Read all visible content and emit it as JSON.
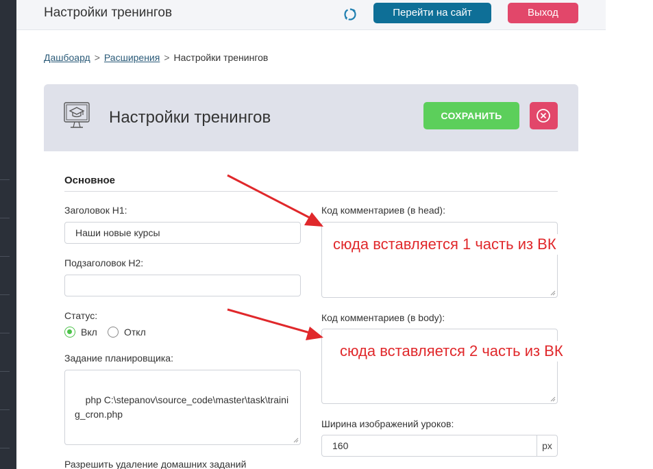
{
  "topbar": {
    "title": "Настройки тренингов",
    "sync_icon": "sync-icon",
    "go_to_site_label": "Перейти на сайт",
    "logout_label": "Выход"
  },
  "breadcrumb": {
    "items": [
      "Дашбоард",
      "Расширения",
      "Настройки тренингов"
    ],
    "separator": ">"
  },
  "panel": {
    "icon": "monitor-graduation-cap-icon",
    "title": "Настройки тренингов",
    "save_label": "СОХРАНИТЬ",
    "close_icon": "close-circle-icon"
  },
  "section": {
    "title": "Основное"
  },
  "form": {
    "h1_label": "Заголовок H1:",
    "h1_value": "Наши новые курсы",
    "h2_label": "Подзаголовок H2:",
    "h2_value": "",
    "status_label": "Статус:",
    "status_on": "Вкл",
    "status_off": "Откл",
    "status_selected": "Вкл",
    "cron_label": "Задание планировщика:",
    "cron_value": "php C:\\stepanov\\source_code\\master\\task\\trainig_cron.php",
    "allow_delete_label": "Разрешить удаление домашних заданий",
    "head_code_label": "Код комментариев (в head):",
    "body_code_label": "Код комментариев (в body):",
    "image_width_label": "Ширина изображений уроков:",
    "image_width_value": "160",
    "image_width_unit": "px"
  },
  "annotations": {
    "head_note": "сюда вставляется 1 часть из ВК",
    "body_note": "сюда вставляется 2 часть из ВК"
  },
  "colors": {
    "primary": "#0e6f97",
    "danger": "#e2476a",
    "success": "#5ccf5b",
    "annotation": "#e0282b",
    "panel_header": "#dfe1ea"
  }
}
